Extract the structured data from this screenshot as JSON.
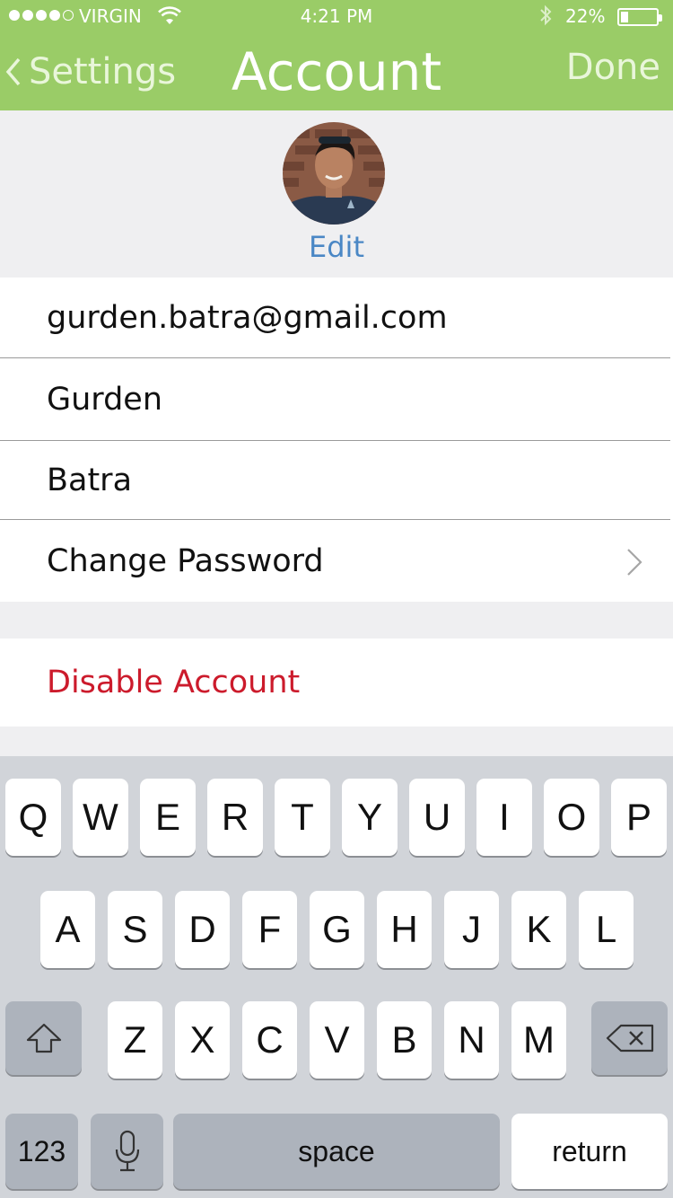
{
  "status_bar": {
    "carrier": "VIRGIN",
    "time": "4:21 PM",
    "battery_percent": "22%",
    "signal_bars_filled": 4,
    "signal_bars_total": 5,
    "battery_level": 0.22
  },
  "nav": {
    "back_label": "Settings",
    "title": "Account",
    "done_label": "Done"
  },
  "profile": {
    "edit_label": "Edit"
  },
  "form": {
    "email": "gurden.batra@gmail.com",
    "first_name": "Gurden",
    "last_name": "Batra",
    "change_password_label": "Change Password"
  },
  "danger": {
    "disable_label": "Disable Account"
  },
  "keyboard": {
    "row1": [
      "Q",
      "W",
      "E",
      "R",
      "T",
      "Y",
      "U",
      "I",
      "O",
      "P"
    ],
    "row2": [
      "A",
      "S",
      "D",
      "F",
      "G",
      "H",
      "J",
      "K",
      "L"
    ],
    "row3": [
      "Z",
      "X",
      "C",
      "V",
      "B",
      "N",
      "M"
    ],
    "numbers_label": "123",
    "space_label": "space",
    "return_label": "return"
  },
  "colors": {
    "nav_bar": "#9acc67",
    "link_blue": "#4a87c5",
    "destructive_red": "#cc1b2c"
  }
}
